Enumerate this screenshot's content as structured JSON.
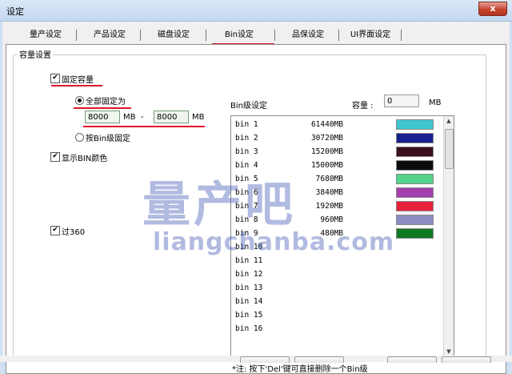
{
  "window": {
    "title": "设定",
    "close_label": "x"
  },
  "tabs": [
    {
      "label": "量产设定"
    },
    {
      "label": "产品设定"
    },
    {
      "label": "磁盘设定"
    },
    {
      "label": "Bin设定"
    },
    {
      "label": "品保设定"
    },
    {
      "label": "UI界面设定"
    }
  ],
  "active_tab": "Bin设定",
  "group": {
    "legend": "容量设置"
  },
  "fixed_capacity": {
    "label": "固定容量",
    "checked": true
  },
  "all_fixed": {
    "label": "全部固定为",
    "selected": true,
    "min": "8000",
    "max": "8000",
    "unit": "MB",
    "dash": "-"
  },
  "by_bin": {
    "label": "按Bin级固定",
    "selected": false
  },
  "show_bin_color": {
    "label": "显示BIN颜色",
    "checked": true
  },
  "pass360": {
    "label": "过360",
    "checked": true
  },
  "bin_settings": {
    "label": "Bin级设定",
    "capacity_label": "容量 :",
    "capacity_value": "0",
    "capacity_unit": "MB"
  },
  "bins": [
    {
      "name": "bin 1",
      "size": "61440MB",
      "color": "#3fc6cf"
    },
    {
      "name": "bin 2",
      "size": "30720MB",
      "color": "#17208f"
    },
    {
      "name": "bin 3",
      "size": "15200MB",
      "color": "#3a0f1f"
    },
    {
      "name": "bin 4",
      "size": "15000MB",
      "color": "#0c0c0c"
    },
    {
      "name": "bin 5",
      "size": "7680MB",
      "color": "#52d48a"
    },
    {
      "name": "bin 6",
      "size": "3840MB",
      "color": "#a43fae"
    },
    {
      "name": "bin 7",
      "size": "1920MB",
      "color": "#e8213a"
    },
    {
      "name": "bin 8",
      "size": "960MB",
      "color": "#8d8dc4"
    },
    {
      "name": "bin 9",
      "size": "480MB",
      "color": "#0f7a24"
    },
    {
      "name": "bin 10",
      "size": "",
      "color": ""
    },
    {
      "name": "bin 11",
      "size": "",
      "color": ""
    },
    {
      "name": "bin 12",
      "size": "",
      "color": ""
    },
    {
      "name": "bin 13",
      "size": "",
      "color": ""
    },
    {
      "name": "bin 14",
      "size": "",
      "color": ""
    },
    {
      "name": "bin 15",
      "size": "",
      "color": ""
    },
    {
      "name": "bin 16",
      "size": "",
      "color": ""
    }
  ],
  "note": "*注: 按下'Del'键可直接删除一个Bin级",
  "watermark": {
    "text": "量产吧",
    "url": "liangchanba.com"
  },
  "colors": {
    "annotation_red": "#e0162b",
    "titlebar": "#c3d7ee"
  },
  "icons": {
    "checkbox_mark": "✔",
    "scroll_up": "▲",
    "scroll_down": "▼"
  }
}
